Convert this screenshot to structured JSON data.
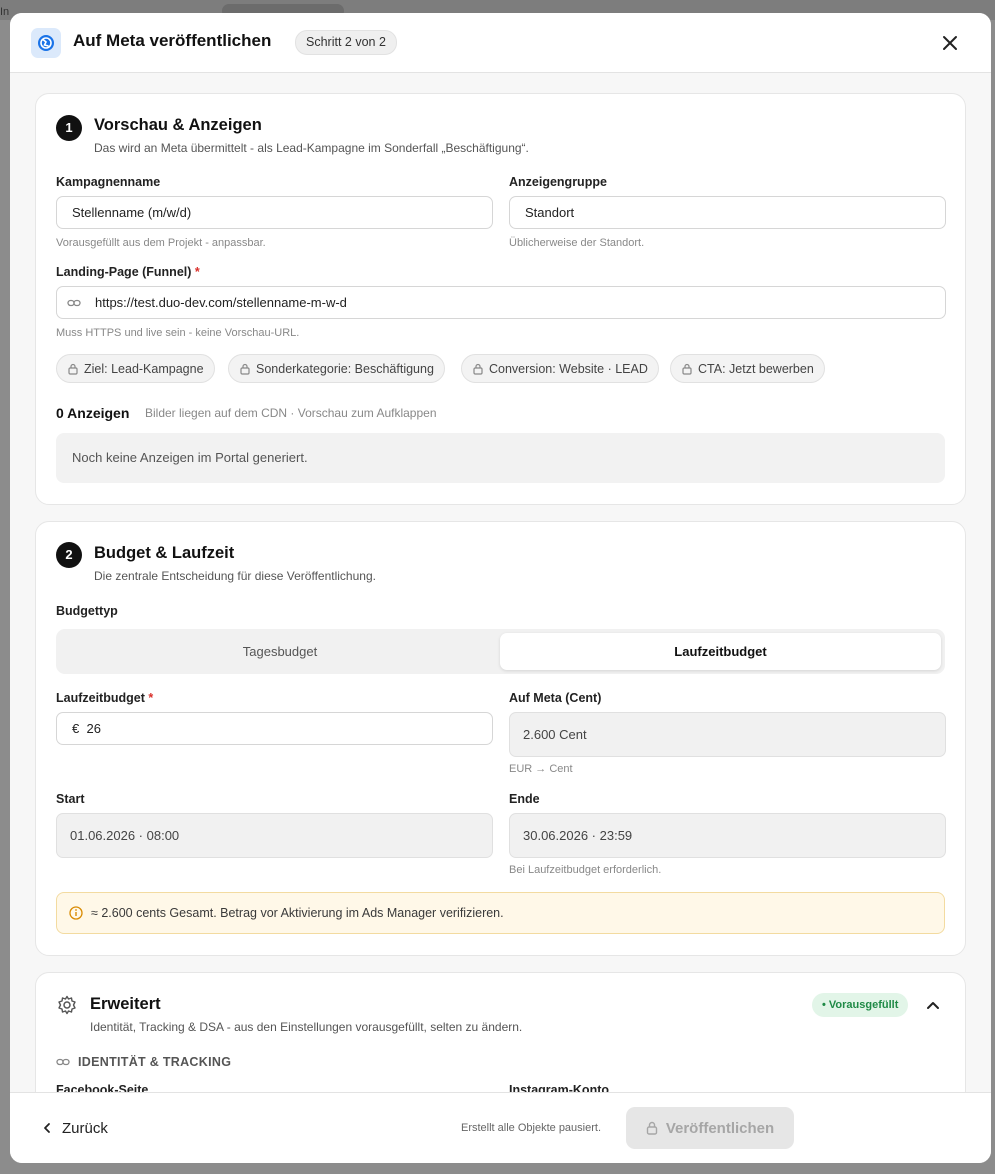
{
  "backdrop": {
    "fragment": "In"
  },
  "header": {
    "title": "Auf Meta veröffentlichen",
    "step": "Schritt 2 von 2"
  },
  "section1": {
    "number": "1",
    "title": "Vorschau & Anzeigen",
    "subtitle": "Das wird an Meta übermittelt - als Lead-Kampagne im Sonderfall „Beschäftigung“.",
    "campaign": {
      "label": "Kampagnenname",
      "value": "Stellenname (m/w/d)",
      "hint": "Vorausgefüllt aus dem Projekt - anpassbar."
    },
    "adgroup": {
      "label": "Anzeigengruppe",
      "value": "Standort",
      "hint": "Üblicherweise der Standort."
    },
    "landing": {
      "label": "Landing-Page (Funnel)",
      "required": "*",
      "value": "https://test.duo-dev.com/stellenname-m-w-d",
      "hint": "Muss HTTPS und live sein - keine Vorschau-URL."
    },
    "chips": [
      "Ziel: Lead-Kampagne",
      "Sonderkategorie: Beschäftigung",
      "Conversion: Website · LEAD",
      "CTA: Jetzt bewerben"
    ],
    "ads": {
      "count": "0 Anzeigen",
      "meta": "Bilder liegen auf dem CDN · Vorschau zum Aufklappen",
      "empty": "Noch keine Anzeigen im Portal generiert."
    }
  },
  "section2": {
    "number": "2",
    "title": "Budget & Laufzeit",
    "subtitle": "Die zentrale Entscheidung für diese Veröffentlichung.",
    "budget_type": {
      "label": "Budgettyp",
      "options": [
        "Tagesbudget",
        "Laufzeitbudget"
      ],
      "selected": "Laufzeitbudget"
    },
    "budget": {
      "label": "Laufzeitbudget",
      "required": "*",
      "currency": "€",
      "value": "26"
    },
    "meta_cent": {
      "label": "Auf Meta (Cent)",
      "value": "2.600 Cent",
      "hint": "EUR → Cent"
    },
    "start": {
      "label": "Start",
      "value": "01.06.2026 · 08:00"
    },
    "end": {
      "label": "Ende",
      "value": "30.06.2026 · 23:59",
      "hint": "Bei Laufzeitbudget erforderlich."
    },
    "warning": "≈ 2.600 cents Gesamt. Betrag vor Aktivierung im Ads Manager verifizieren."
  },
  "advanced": {
    "title": "Erweitert",
    "subtitle": "Identität, Tracking & DSA - aus den Einstellungen vorausgefüllt, selten zu ändern.",
    "badge": "• Vorausgefüllt",
    "group_title": "IDENTITÄT & TRACKING",
    "facebook_label": "Facebook-Seite",
    "instagram_label": "Instagram-Konto"
  },
  "footer": {
    "back": "Zurück",
    "note": "Erstellt alle Objekte pausiert.",
    "publish": "Veröffentlichen"
  },
  "colors": {
    "accent": "#1a73e8",
    "badge_green": "#1f8a46",
    "warning_bg": "#fff8e8",
    "required": "#d9302b"
  },
  "icons": [
    "globe-icon",
    "close-icon",
    "link-icon",
    "lock-icon",
    "info-icon",
    "gear-icon",
    "chevron-up-icon",
    "chevron-left-icon"
  ]
}
